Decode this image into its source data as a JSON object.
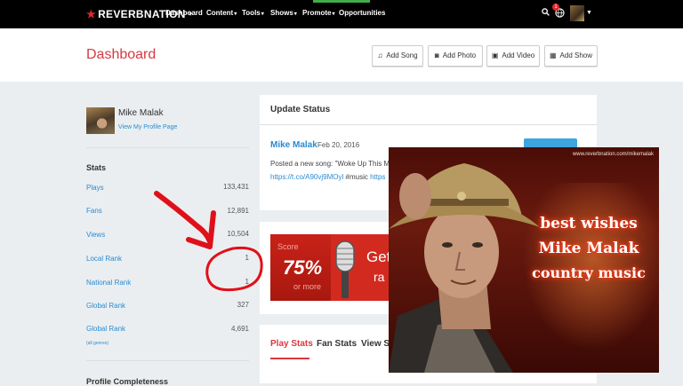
{
  "nav": {
    "logo": "REVERBNATION",
    "links": [
      "Dashboard",
      "Content",
      "Tools",
      "Shows",
      "Promote",
      "Opportunities"
    ],
    "notification_count": "1"
  },
  "header": {
    "title": "Dashboard",
    "buttons": [
      "Add Song",
      "Add Photo",
      "Add Video",
      "Add Show"
    ]
  },
  "profile": {
    "name": "Mike Malak",
    "link": "View My Profile Page"
  },
  "stats": {
    "title": "Stats",
    "rows": [
      {
        "label": "Plays",
        "value": "133,431"
      },
      {
        "label": "Fans",
        "value": "12,891"
      },
      {
        "label": "Views",
        "value": "10,504"
      },
      {
        "label": "Local Rank",
        "value": "1"
      },
      {
        "label": "National Rank",
        "value": "1"
      },
      {
        "label": "Global Rank",
        "value": "327"
      },
      {
        "label": "Global Rank",
        "value": "4,691"
      }
    ],
    "sub_label": "(all genres)",
    "profile_completeness": "Profile Completeness"
  },
  "update": {
    "title": "Update Status",
    "author": "Mike Malak",
    "date": "Feb 20, 2016",
    "text": "Posted a new song: \"Woke Up This Mo",
    "link": "https://t.co/A90vj9MOyl",
    "tag": "#music",
    "link2": "https"
  },
  "promo": {
    "score_label": "Score",
    "percent": "75%",
    "more": "or more",
    "get": "Get",
    "ra": "ra"
  },
  "tabs": [
    "Play Stats",
    "Fan Stats",
    "View St"
  ],
  "photo": {
    "url": "www.reverbnation.com/mikemalak",
    "line1": "best wishes",
    "line2": "Mike Malak",
    "line3": "country music"
  },
  "colors": {
    "brand_red": "#d9383f",
    "link_blue": "#2a8bd0",
    "annotation_red": "#e0101a"
  }
}
